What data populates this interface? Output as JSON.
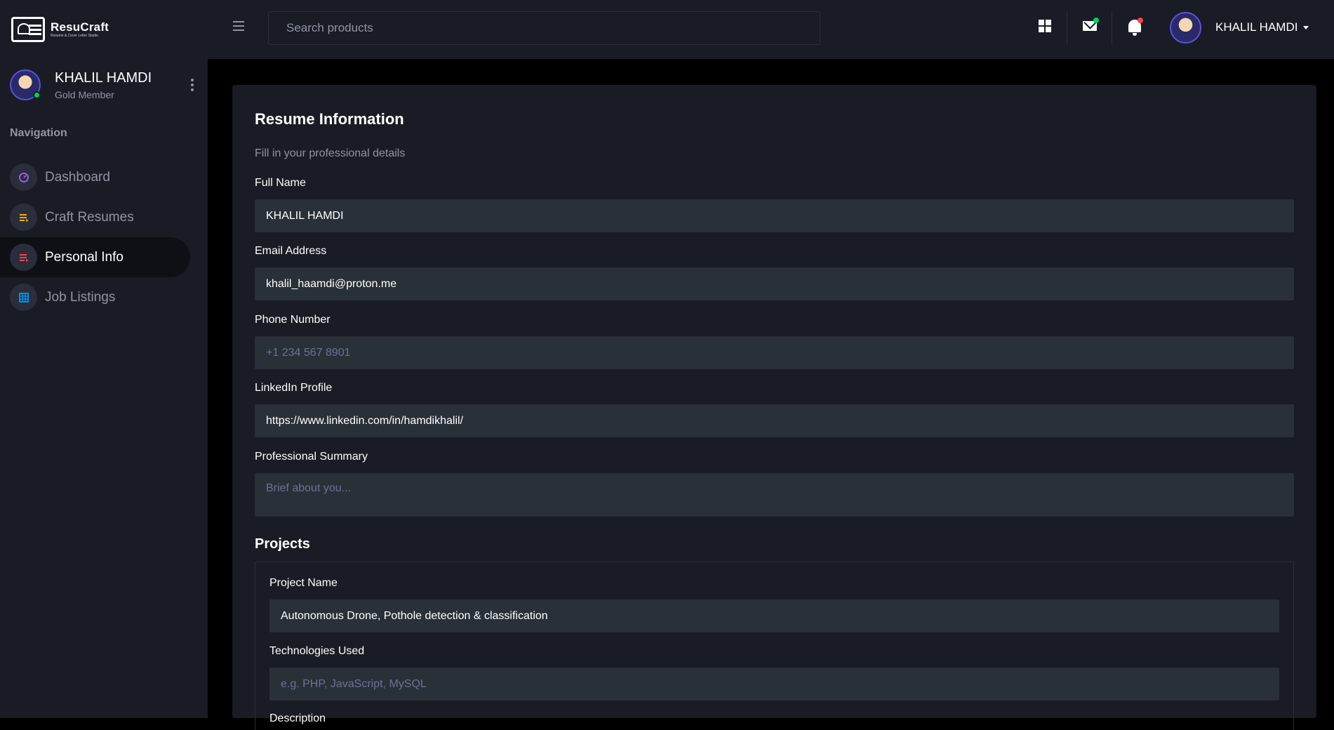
{
  "brand": {
    "name": "ResuCraft",
    "tagline": "Resume & Cover Letter Studio"
  },
  "topbar": {
    "search_placeholder": "Search products",
    "user_name": "KHALIL HAMDI",
    "icons": [
      "menu-icon",
      "grid-icon",
      "mail-icon",
      "bell-icon"
    ],
    "mail_badge_color": "#00d25b",
    "bell_badge_color": "#fc424a"
  },
  "sidebar": {
    "profile": {
      "name": "KHALIL HAMDI",
      "level": "Gold Member"
    },
    "nav_heading": "Navigation",
    "items": [
      {
        "label": "Dashboard",
        "icon": "speedometer-icon",
        "color": "#8f5fe8",
        "active": false
      },
      {
        "label": "Craft Resumes",
        "icon": "playlist-icon",
        "color": "#ffab00",
        "active": false
      },
      {
        "label": "Personal Info",
        "icon": "playlist-icon",
        "color": "#fc424a",
        "active": true
      },
      {
        "label": "Job Listings",
        "icon": "table-icon",
        "color": "#0090e7",
        "active": false
      }
    ]
  },
  "form": {
    "title": "Resume Information",
    "subtitle": "Fill in your professional details",
    "full_name": {
      "label": "Full Name",
      "value": "KHALIL HAMDI",
      "placeholder": ""
    },
    "email": {
      "label": "Email Address",
      "value": "khalil_haamdi@proton.me",
      "placeholder": ""
    },
    "phone": {
      "label": "Phone Number",
      "value": "",
      "placeholder": "+1 234 567 8901"
    },
    "linkedin": {
      "label": "LinkedIn Profile",
      "value": "https://www.linkedin.com/in/hamdikhalil/",
      "placeholder": ""
    },
    "summary": {
      "label": "Professional Summary",
      "value": "",
      "placeholder": "Brief about you..."
    }
  },
  "projects": {
    "title": "Projects",
    "project_name": {
      "label": "Project Name",
      "value": "Autonomous Drone, Pothole detection & classification"
    },
    "technologies": {
      "label": "Technologies Used",
      "value": "",
      "placeholder": "e.g. PHP, JavaScript, MySQL"
    },
    "description": {
      "label": "Description"
    }
  }
}
